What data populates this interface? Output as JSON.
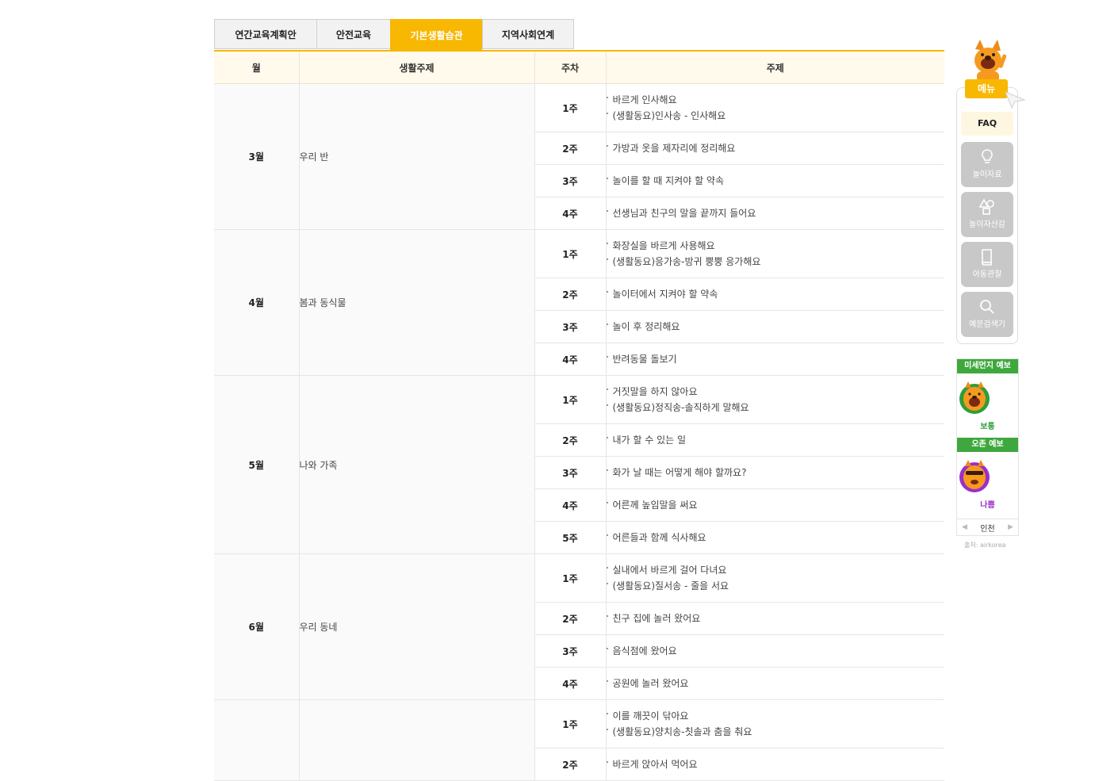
{
  "tabs": [
    {
      "label": "연간교육계획안",
      "active": false
    },
    {
      "label": "안전교육",
      "active": false
    },
    {
      "label": "기본생활습관",
      "active": true
    },
    {
      "label": "지역사회연계",
      "active": false
    }
  ],
  "table": {
    "headers": [
      "월",
      "생활주제",
      "주차",
      "주제"
    ],
    "months": [
      {
        "month": "3월",
        "theme": "우리 반",
        "weeks": [
          {
            "week": "1주",
            "topics": [
              "바르게 인사해요",
              "(생활동요)인사송 - 인사해요"
            ]
          },
          {
            "week": "2주",
            "topics": [
              "가방과 옷을 제자리에 정리해요"
            ]
          },
          {
            "week": "3주",
            "topics": [
              "놀이를 할 때 지켜야 할 약속"
            ]
          },
          {
            "week": "4주",
            "topics": [
              "선생님과 친구의 말을 끝까지 들어요"
            ]
          }
        ]
      },
      {
        "month": "4월",
        "theme": "봄과 동식물",
        "weeks": [
          {
            "week": "1주",
            "topics": [
              "화장실을 바르게 사용해요",
              "(생활동요)응가송-방귀 뿡뿡 응가해요"
            ]
          },
          {
            "week": "2주",
            "topics": [
              "놀이터에서 지켜야 할 약속"
            ]
          },
          {
            "week": "3주",
            "topics": [
              "놀이 후 정리해요"
            ]
          },
          {
            "week": "4주",
            "topics": [
              "반려동물 돌보기"
            ]
          }
        ]
      },
      {
        "month": "5월",
        "theme": "나와 가족",
        "weeks": [
          {
            "week": "1주",
            "topics": [
              "거짓말을 하지 않아요",
              "(생활동요)정직송-솔직하게 말해요"
            ]
          },
          {
            "week": "2주",
            "topics": [
              "내가 할 수 있는 일"
            ]
          },
          {
            "week": "3주",
            "topics": [
              "화가 날 때는 어떻게 해야 할까요?"
            ]
          },
          {
            "week": "4주",
            "topics": [
              "어른께 높임말을 써요"
            ]
          },
          {
            "week": "5주",
            "topics": [
              "어른들과 함께 식사해요"
            ]
          }
        ]
      },
      {
        "month": "6월",
        "theme": "우리 동네",
        "weeks": [
          {
            "week": "1주",
            "topics": [
              "실내에서 바르게 걸어 다녀요",
              "(생활동요)질서송 - 줄을 서요"
            ]
          },
          {
            "week": "2주",
            "topics": [
              "친구 집에 놀러 왔어요"
            ]
          },
          {
            "week": "3주",
            "topics": [
              "음식점에 왔어요"
            ]
          },
          {
            "week": "4주",
            "topics": [
              "공원에 놀러 왔어요"
            ]
          }
        ]
      },
      {
        "month": "",
        "theme": "",
        "weeks": [
          {
            "week": "1주",
            "topics": [
              "이를 깨끗이 닦아요",
              "(생활동요)양치송-칫솔과 춤을 춰요"
            ]
          },
          {
            "week": "2주",
            "topics": [
              "바르게 앉아서 먹어요"
            ]
          }
        ]
      }
    ]
  },
  "side_menu": {
    "menu_label": "메뉴",
    "faq_label": "FAQ",
    "buttons": [
      {
        "label": "놀이자료",
        "icon": "lightbulb-icon"
      },
      {
        "label": "놀이자산감",
        "icon": "shapes-icon"
      },
      {
        "label": "아동관찰",
        "icon": "book-icon"
      },
      {
        "label": "예문검색기",
        "icon": "search-icon"
      }
    ]
  },
  "air": {
    "dust_title": "미세먼지 예보",
    "dust_status": "보통",
    "ozone_title": "오존 예보",
    "ozone_status": "나쁨",
    "region": "인천",
    "source": "출처: airkorea"
  },
  "colors": {
    "accent": "#f8b700",
    "header_bg": "#fffaeb",
    "good_green": "#3ea83e",
    "bad_purple": "#9b2fc9"
  }
}
